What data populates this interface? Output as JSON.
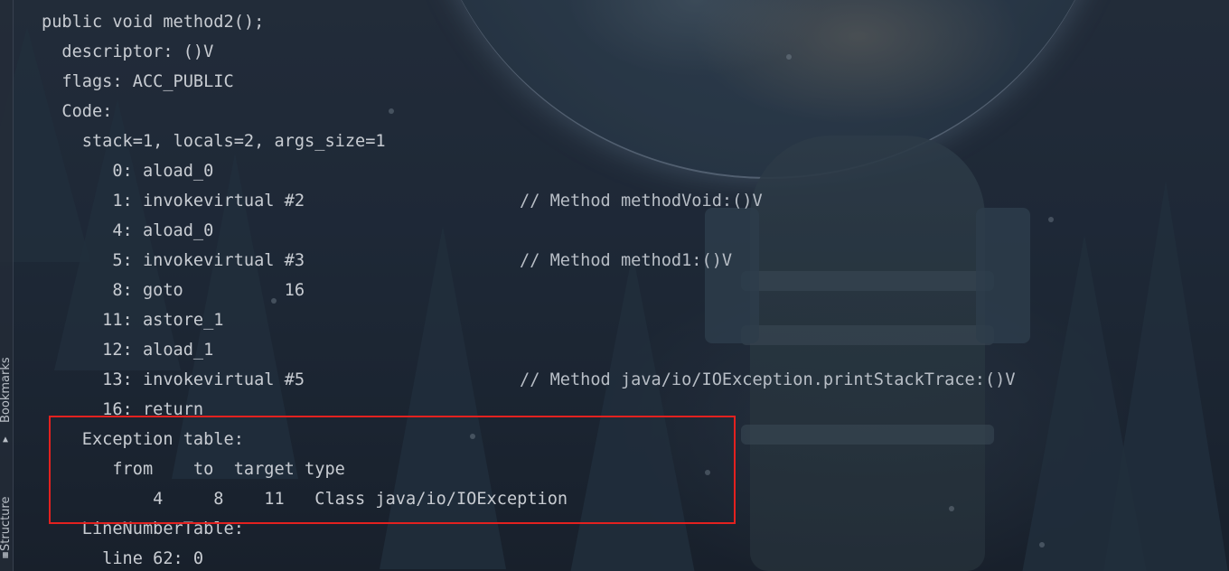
{
  "editor": {
    "lines": [
      "public void method2();",
      "  descriptor: ()V",
      "  flags: ACC_PUBLIC",
      "  Code:",
      "    stack=1, locals=2, args_size=1",
      "       0: aload_0",
      "       1: invokevirtual #2",
      "       4: aload_0",
      "       5: invokevirtual #3",
      "       8: goto          16",
      "      11: astore_1",
      "      12: aload_1",
      "      13: invokevirtual #5",
      "      16: return",
      "    Exception table:",
      "       from    to  target type",
      "           4     8    11   Class java/io/IOException",
      "    LineNumberTable:",
      "      line 62: 0"
    ],
    "comments": {
      "line6": "// Method methodVoid:()V",
      "line8": "// Method method1:()V",
      "line12": "// Method java/io/IOException.printStackTrace:()V"
    }
  },
  "side_panel": {
    "bookmarks_label": "Bookmarks",
    "structure_label": "Structure",
    "bookmarks_icon": "bookmark-icon",
    "structure_icon": "structure-icon"
  },
  "colors": {
    "text": "#c8ccd2",
    "highlight_border": "#e3211f"
  }
}
